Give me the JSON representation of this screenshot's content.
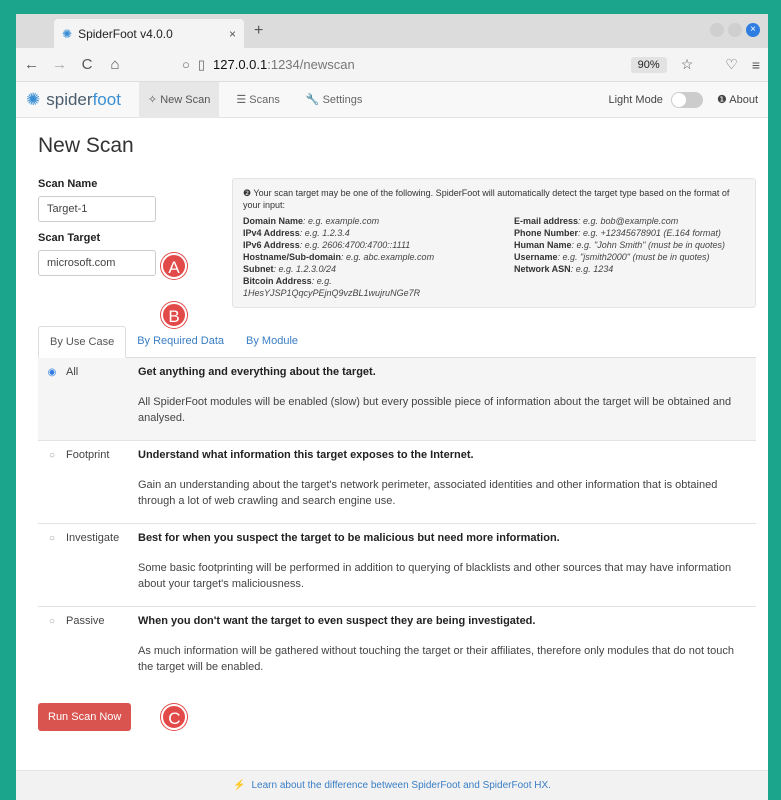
{
  "browser": {
    "tab_title": "SpiderFoot v4.0.0",
    "tab_close": "×",
    "new_tab": "+",
    "url_host": "127.0.0.1",
    "url_path": ":1234/newscan",
    "zoom": "90%",
    "back_icon": "←",
    "forward_icon": "→",
    "reload_icon": "C",
    "home_icon": "⌂",
    "star_icon": "☆",
    "pocket_icon": "♡",
    "menu_icon": "≡"
  },
  "app": {
    "brand_1": "spider",
    "brand_2": "foot",
    "nav": {
      "new_scan": "✧ New Scan",
      "scans": "☰ Scans",
      "settings": "🔧 Settings"
    },
    "light_mode": "Light Mode",
    "about": "❶ About"
  },
  "page": {
    "title": "New Scan",
    "scan_name_label": "Scan Name",
    "scan_name_value": "Target-1",
    "scan_target_label": "Scan Target",
    "scan_target_value": "microsoft.com"
  },
  "markers": {
    "a": "A",
    "b": "B",
    "c": "C"
  },
  "hint": {
    "intro": "❷ Your scan target may be one of the following. SpiderFoot will automatically detect the target type based on the format of your input:",
    "left": [
      {
        "label": "Domain Name",
        "example": ": e.g. example.com"
      },
      {
        "label": "IPv4 Address",
        "example": ": e.g. 1.2.3.4"
      },
      {
        "label": "IPv6 Address",
        "example": ": e.g. 2606:4700:4700::1111"
      },
      {
        "label": "Hostname/Sub-domain",
        "example": ": e.g. abc.example.com"
      },
      {
        "label": "Subnet",
        "example": ": e.g. 1.2.3.0/24"
      },
      {
        "label": "Bitcoin Address",
        "example": ": e.g. 1HesYJSP1QqcyPEjnQ9vzBL1wujruNGe7R"
      }
    ],
    "right": [
      {
        "label": "E-mail address",
        "example": ": e.g. bob@example.com"
      },
      {
        "label": "Phone Number",
        "example": ": e.g. +12345678901 (E.164 format)"
      },
      {
        "label": "Human Name",
        "example": ": e.g. \"John Smith\" (must be in quotes)"
      },
      {
        "label": "Username",
        "example": ": e.g. \"jsmith2000\" (must be in quotes)"
      },
      {
        "label": "Network ASN",
        "example": ": e.g. 1234"
      }
    ]
  },
  "tabs": [
    "By Use Case",
    "By Required Data",
    "By Module"
  ],
  "cases": [
    {
      "name": "All",
      "title": "Get anything and everything about the target.",
      "desc": "All SpiderFoot modules will be enabled (slow) but every possible piece of information about the target will be obtained and analysed."
    },
    {
      "name": "Footprint",
      "title": "Understand what information this target exposes to the Internet.",
      "desc": "Gain an understanding about the target's network perimeter, associated identities and other information that is obtained through a lot of web crawling and search engine use."
    },
    {
      "name": "Investigate",
      "title": "Best for when you suspect the target to be malicious but need more information.",
      "desc": "Some basic footprinting will be performed in addition to querying of blacklists and other sources that may have information about your target's maliciousness."
    },
    {
      "name": "Passive",
      "title": "When you don't want the target to even suspect they are being investigated.",
      "desc": "As much information will be gathered without touching the target or their affiliates, therefore only modules that do not touch the target will be enabled."
    }
  ],
  "run_button": "Run Scan Now",
  "footer": {
    "bolt": "⚡",
    "link": "Learn about the difference between SpiderFoot and SpiderFoot HX."
  }
}
